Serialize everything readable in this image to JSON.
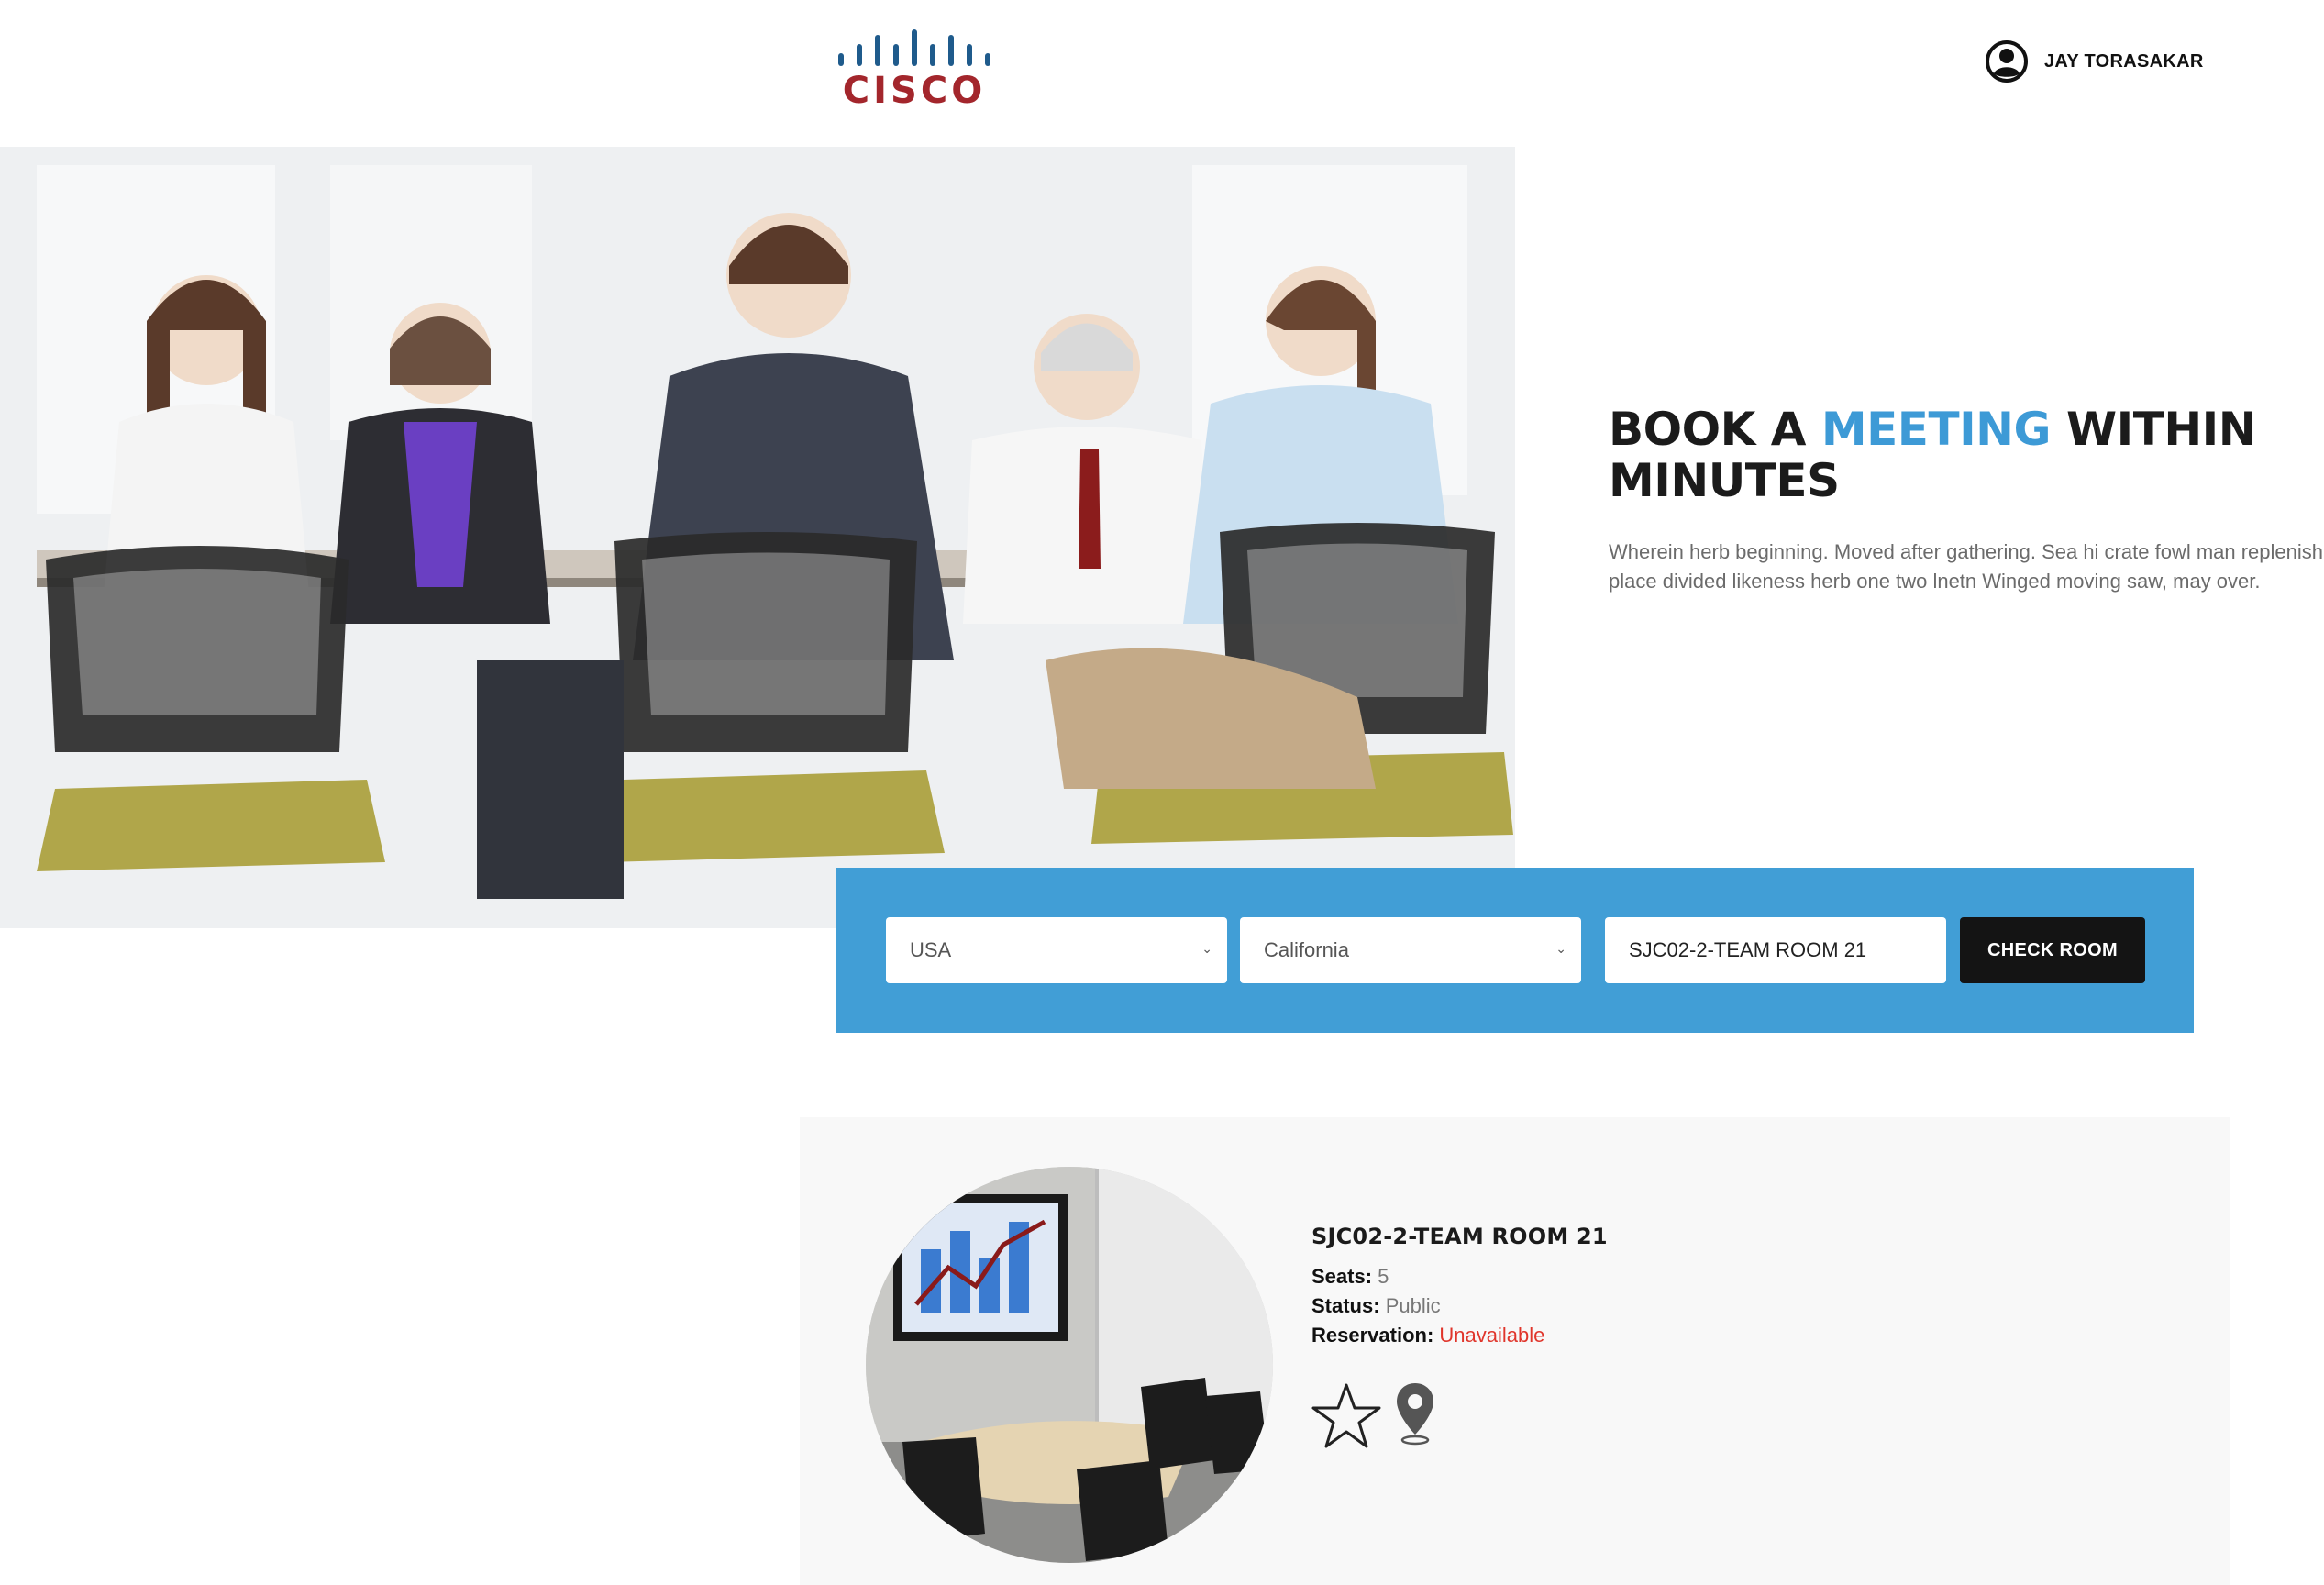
{
  "header": {
    "logo_text": "CISCO",
    "user_name": "JAY TORASAKAR"
  },
  "hero": {
    "title_part1": "BOOK A ",
    "title_accent": "MEETING",
    "title_part2": " WITHIN MINUTES",
    "description": "Wherein herb beginning. Moved after gathering. Sea hi crate fowl man replenish place divided likeness herb one two lnetn Winged moving saw, may over."
  },
  "search": {
    "country": "USA",
    "state": "California",
    "room": "SJC02-2-TEAM ROOM 21",
    "check_label": "CHECK ROOM"
  },
  "result": {
    "room_name": "SJC02-2-TEAM ROOM 21",
    "seats_label": "Seats:",
    "seats_value": "5",
    "status_label": "Status:",
    "status_value": "Public",
    "reservation_label": "Reservation:",
    "reservation_value": "Unavailable"
  },
  "colors": {
    "accent": "#3d9ad6",
    "search_bar": "#419ed6",
    "unavailable": "#e0352b",
    "logo_red": "#a3262c",
    "logo_blue": "#1f5b8c"
  },
  "icons": [
    "cisco-logo",
    "user-icon",
    "chevron-down-icon",
    "star-icon",
    "map-pin-icon"
  ]
}
